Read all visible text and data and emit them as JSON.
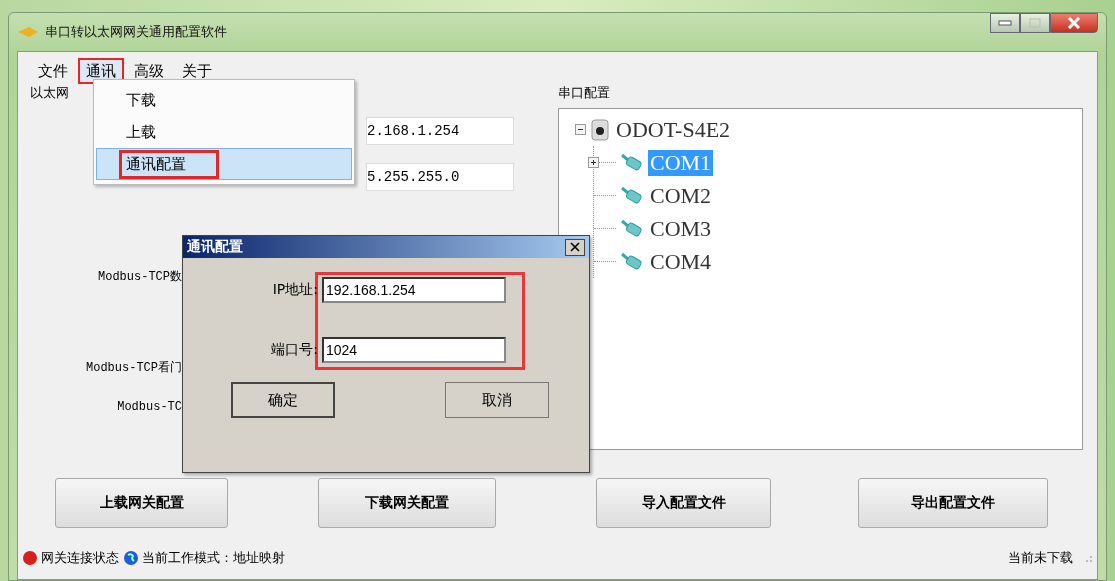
{
  "window": {
    "title": "串口转以太网网关通用配置软件"
  },
  "menu_bar": [
    {
      "label": "文件",
      "selected": false,
      "annotated": false
    },
    {
      "label": "通讯",
      "selected": true,
      "annotated": true
    },
    {
      "label": "高级",
      "selected": false,
      "annotated": false
    },
    {
      "label": "关于",
      "selected": false,
      "annotated": false
    }
  ],
  "dropdown": [
    {
      "label": "下载",
      "selected": false,
      "annotated": false
    },
    {
      "label": "上载",
      "selected": false,
      "annotated": false
    },
    {
      "label": "通讯配置",
      "selected": true,
      "annotated": true
    }
  ],
  "ethernet_panel": {
    "title": "以太网",
    "fields": [
      {
        "value": "2.168.1.254"
      },
      {
        "value": "5.255.255.0"
      }
    ],
    "labels": [
      {
        "label": "Modbus-TCP数"
      },
      {
        "label": "Modbus-TCP看门"
      },
      {
        "label": "Modbus-TC"
      }
    ]
  },
  "serial_panel": {
    "title": "串口配置",
    "tree": {
      "label": "ODOT-S4E2",
      "expanded": true,
      "children": [
        {
          "label": "COM1",
          "selected": true,
          "collapsed": true
        },
        {
          "label": "COM2",
          "selected": false,
          "collapsed": false
        },
        {
          "label": "COM3",
          "selected": false,
          "collapsed": false
        },
        {
          "label": "COM4",
          "selected": false,
          "collapsed": false
        }
      ]
    }
  },
  "buttons": [
    "上载网关配置",
    "下载网关配置",
    "导入配置文件",
    "导出配置文件"
  ],
  "dialog": {
    "title": "通讯配置",
    "fields_annotated": true,
    "fields": [
      {
        "label": "IP地址:",
        "value": "192.168.1.254"
      },
      {
        "label": "端口号:",
        "value": "1024"
      }
    ],
    "buttons": [
      {
        "label": "确定",
        "default": true
      },
      {
        "label": "取消",
        "default": false
      }
    ]
  },
  "status_bar": {
    "items": [
      {
        "kind": "led",
        "label": "网关连接状态",
        "color": "#d42020"
      },
      {
        "kind": "globe",
        "label": "当前工作模式：地址映射",
        "color": "#1e5fd0"
      }
    ],
    "right": "当前未下载"
  }
}
